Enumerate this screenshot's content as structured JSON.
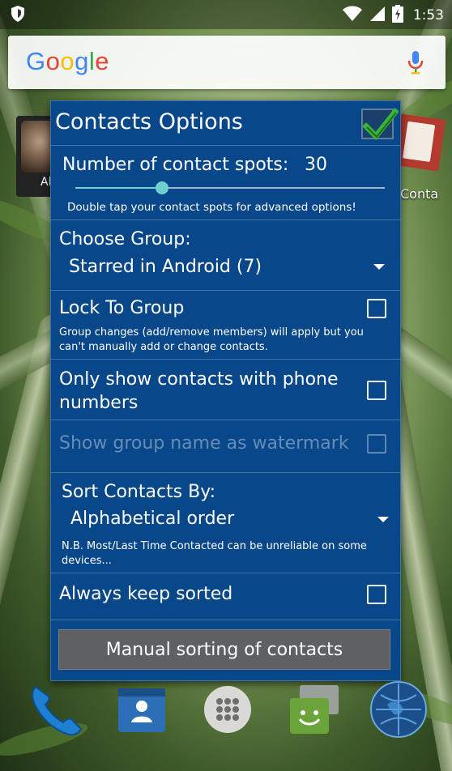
{
  "status_bar": {
    "time": "1:53",
    "icons": [
      "shield-icon",
      "wifi-icon",
      "cell-signal-icon",
      "battery-charging-icon"
    ]
  },
  "search_widget": {
    "logo_text": "Google",
    "logo_colors": [
      "#4285F4",
      "#EA4335",
      "#FBBC05",
      "#4285F4",
      "#34A853",
      "#EA4335"
    ],
    "mic_icon": "mic-icon"
  },
  "home_partial": {
    "left_contact_label": "Al",
    "right_app_label": "Conta"
  },
  "dialog": {
    "title": "Contacts Options",
    "ok_icon": "checkmark-icon",
    "spots": {
      "label": "Number of contact spots:",
      "value": "30",
      "slider_fraction": 0.28,
      "hint": "Double tap your contact spots for advanced options!"
    },
    "group": {
      "label": "Choose Group:",
      "selected": "Starred in Android (7)"
    },
    "lock": {
      "label": "Lock To Group",
      "description": "Group changes (add/remove members) will apply but you can't manually add or change contacts.",
      "checked": false
    },
    "phone_only": {
      "label": "Only show contacts with phone numbers",
      "checked": false
    },
    "watermark": {
      "label": "Show group name as watermark",
      "checked": false,
      "enabled": false
    },
    "sort": {
      "label": "Sort Contacts By:",
      "selected": "Alphabetical order",
      "note": "N.B. Most/Last Time Contacted can be unreliable on some devices..."
    },
    "keep_sorted": {
      "label": "Always keep sorted",
      "checked": false
    },
    "manual_button": "Manual sorting of contacts"
  },
  "dock": {
    "apps": [
      "phone-icon",
      "contacts-icon",
      "app-drawer-icon",
      "messaging-icon",
      "browser-globe-icon"
    ]
  },
  "colors": {
    "dialog_bg": "#07478a",
    "accent": "#6fd0d0",
    "button_bg": "#5e6062",
    "check_green": "#3cb43c"
  }
}
